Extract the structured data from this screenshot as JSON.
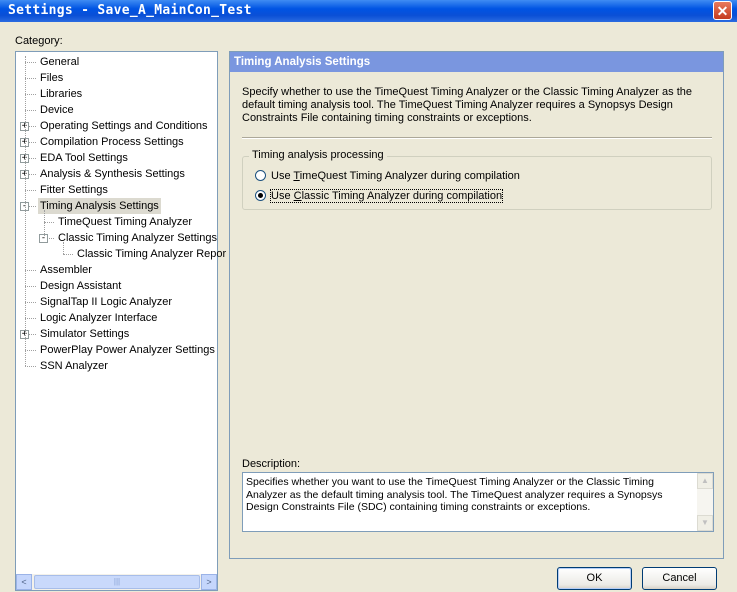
{
  "window": {
    "title": "Settings - Save_A_MainCon_Test",
    "close_icon": "close-icon"
  },
  "category_label": "Category:",
  "tree": {
    "items": [
      {
        "label": "General",
        "level": 0,
        "expander": null
      },
      {
        "label": "Files",
        "level": 0,
        "expander": null
      },
      {
        "label": "Libraries",
        "level": 0,
        "expander": null
      },
      {
        "label": "Device",
        "level": 0,
        "expander": null
      },
      {
        "label": "Operating Settings and Conditions",
        "level": 0,
        "expander": "+"
      },
      {
        "label": "Compilation Process Settings",
        "level": 0,
        "expander": "+"
      },
      {
        "label": "EDA Tool Settings",
        "level": 0,
        "expander": "+"
      },
      {
        "label": "Analysis & Synthesis Settings",
        "level": 0,
        "expander": "+"
      },
      {
        "label": "Fitter Settings",
        "level": 0,
        "expander": null
      },
      {
        "label": "Timing Analysis Settings",
        "level": 0,
        "expander": "-",
        "selected": true
      },
      {
        "label": "TimeQuest Timing Analyzer",
        "level": 1,
        "expander": null
      },
      {
        "label": "Classic Timing Analyzer Settings",
        "level": 1,
        "expander": "-"
      },
      {
        "label": "Classic Timing Analyzer Repor",
        "level": 2,
        "expander": null
      },
      {
        "label": "Assembler",
        "level": 0,
        "expander": null
      },
      {
        "label": "Design Assistant",
        "level": 0,
        "expander": null
      },
      {
        "label": "SignalTap II Logic Analyzer",
        "level": 0,
        "expander": null
      },
      {
        "label": "Logic Analyzer Interface",
        "level": 0,
        "expander": null
      },
      {
        "label": "Simulator Settings",
        "level": 0,
        "expander": "+"
      },
      {
        "label": "PowerPlay Power Analyzer Settings",
        "level": 0,
        "expander": null
      },
      {
        "label": "SSN Analyzer",
        "level": 0,
        "expander": null
      }
    ],
    "scroll_left_icon": "<",
    "scroll_right_icon": ">"
  },
  "panel": {
    "header": "Timing Analysis Settings",
    "intro": "Specify whether to use the TimeQuest Timing Analyzer or the Classic Timing Analyzer as the default timing analysis tool. The TimeQuest Timing Analyzer requires a Synopsys Design Constraints File containing timing constraints or exceptions.",
    "group": {
      "legend": "Timing analysis processing",
      "options": [
        {
          "pre": "Use ",
          "accel": "T",
          "post": "imeQuest Timing Analyzer during compilation",
          "checked": false
        },
        {
          "pre": "Use ",
          "accel": "C",
          "post": "lassic Timing Analyzer during compilation",
          "checked": true
        }
      ]
    },
    "description_label": "Description:",
    "description": "Specifies whether you want to use the TimeQuest Timing Analyzer or the Classic Timing Analyzer as the default timing analysis tool. The TimeQuest analyzer requires a Synopsys Design Constraints File (SDC) containing timing constraints or exceptions."
  },
  "buttons": {
    "ok": "OK",
    "cancel": "Cancel"
  }
}
